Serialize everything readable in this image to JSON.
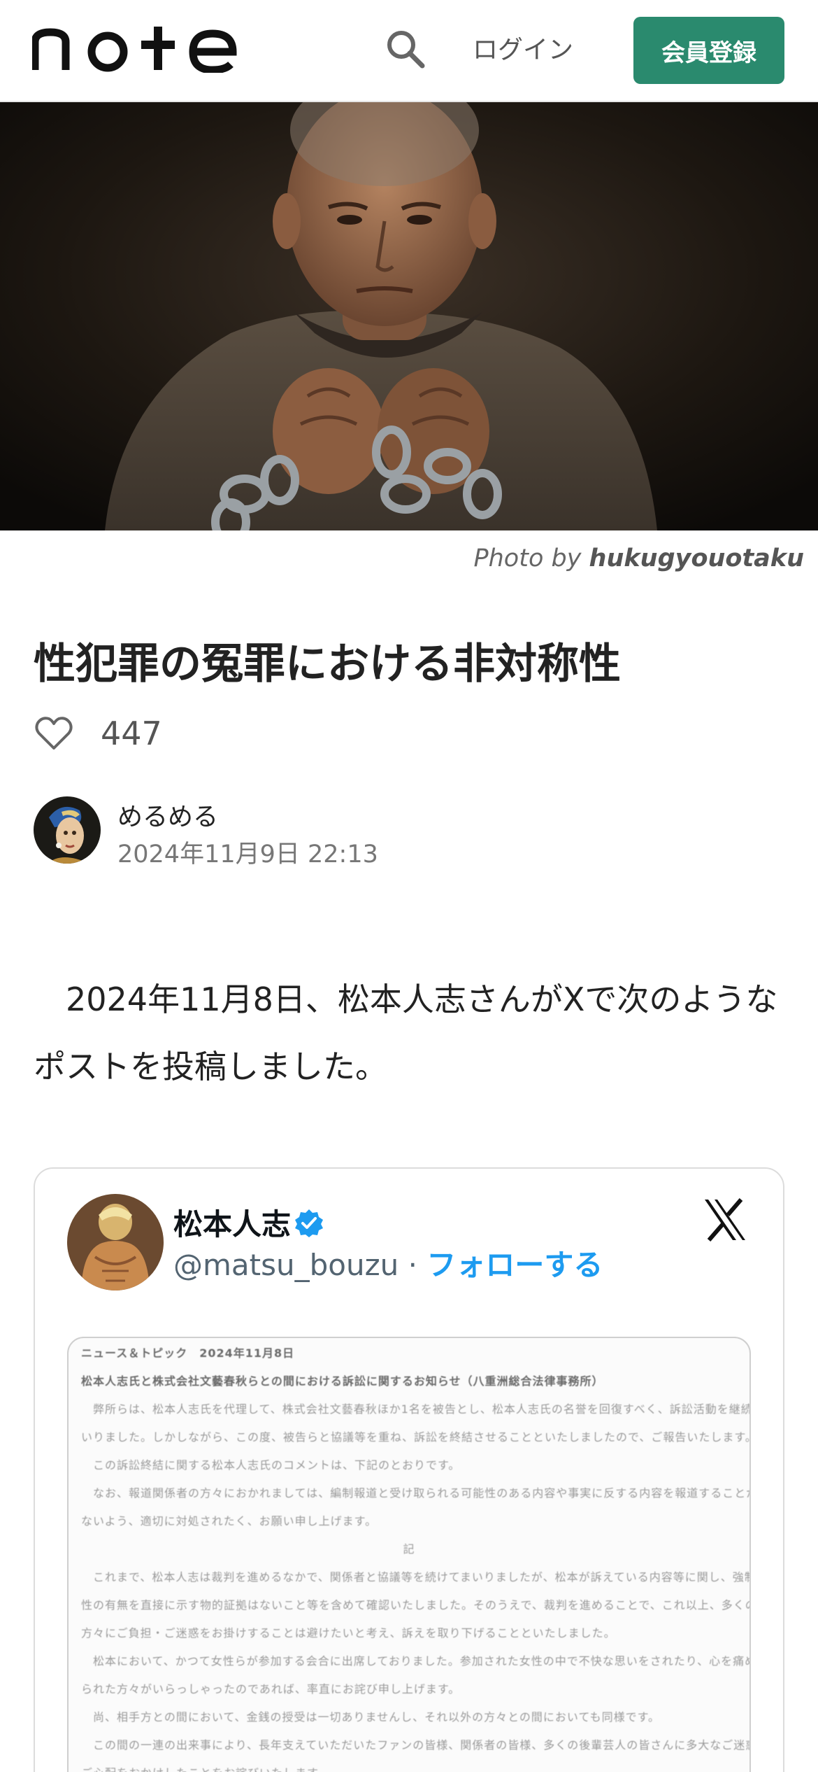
{
  "header": {
    "logo_text": "note",
    "search_icon": "search-icon",
    "login_label": "ログイン",
    "signup_label": "会員登録",
    "accent_color": "#2a8a6e"
  },
  "hero": {
    "credit_prefix": "Photo by ",
    "credit_author": "hukugyouotaku"
  },
  "article": {
    "title": "性犯罪の冤罪における非対称性",
    "like_count": "447",
    "author_name": "めるめる",
    "published": "2024年11月9日 22:13",
    "body": "　2024年11月8日、松本人志さんがXで次のようなポストを投稿しました。"
  },
  "embed": {
    "name": "松本人志",
    "handle": "@matsu_bouzu",
    "separator": " · ",
    "follow_label": "フォローする",
    "brand_icon": "x-logo-icon",
    "verified_color": "#1d9bf0",
    "document_lines": [
      {
        "text": "ニュース＆トピック　2024年11月8日",
        "style": "dark"
      },
      {
        "text": "松本人志氏と株式会社文藝春秋らとの間における訴訟に関するお知らせ（八重洲総合法律事務所）",
        "style": "dark"
      },
      {
        "text": "　弊所らは、松本人志氏を代理して、株式会社文藝春秋ほか1名を被告とし、松本人志氏の名誉を回復すべく、訴訟活動を継続してま",
        "style": ""
      },
      {
        "text": "いりました。しかしながら、この度、被告らと協議等を重ね、訴訟を終結させることといたしましたので、ご報告いたします。",
        "style": ""
      },
      {
        "text": "　この訴訟終結に関する松本人志氏のコメントは、下記のとおりです。",
        "style": ""
      },
      {
        "text": "　なお、報道関係者の方々におかれましては、編制報道と受け取られる可能性のある内容や事実に反する内容を報道することが",
        "style": ""
      },
      {
        "text": "ないよう、適切に対処されたく、お願い申し上げます。",
        "style": ""
      },
      {
        "text": "記",
        "style": "center"
      },
      {
        "text": "　これまで、松本人志は裁判を進めるなかで、関係者と協議等を続けてまいりましたが、松本が訴えている内容等に関し、強制",
        "style": ""
      },
      {
        "text": "性の有無を直接に示す物的証拠はないこと等を含めて確認いたしました。そのうえで、裁判を進めることで、これ以上、多くの",
        "style": ""
      },
      {
        "text": "方々にご負担・ご迷惑をお掛けすることは避けたいと考え、訴えを取り下げることといたしました。",
        "style": ""
      },
      {
        "text": "　松本において、かつて女性らが参加する会合に出席しておりました。参加された女性の中で不快な思いをされたり、心を痛め",
        "style": ""
      },
      {
        "text": "られた方々がいらっしゃったのであれば、率直にお詫び申し上げます。",
        "style": ""
      },
      {
        "text": "　尚、相手方との間において、金銭の授受は一切ありませんし、それ以外の方々との間においても同様です。",
        "style": ""
      },
      {
        "text": "　この間の一連の出来事により、長年支えていただいたファンの皆様、関係者の皆様、多くの後輩芸人の皆さんに多大なご迷惑、",
        "style": ""
      },
      {
        "text": "ご心配をおかけしたことをお詫びいたします。",
        "style": ""
      }
    ]
  }
}
